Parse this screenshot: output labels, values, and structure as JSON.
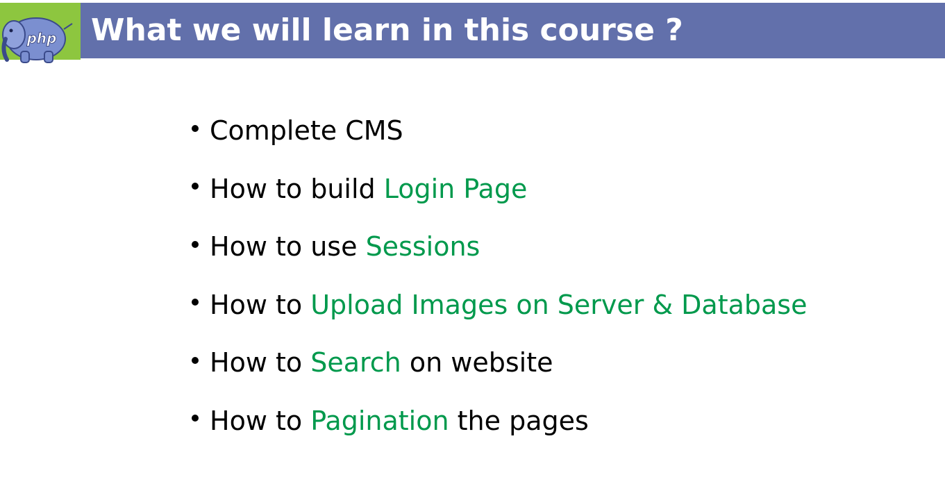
{
  "header": {
    "title": "What we will learn in this course ?",
    "logo_text": "php",
    "colors": {
      "title_bar": "#6270ab",
      "logo_bg": "#8dc63f",
      "highlight": "#00994c"
    }
  },
  "bullets": [
    {
      "plain_before": "Complete CMS",
      "highlight": "",
      "plain_after": ""
    },
    {
      "plain_before": "How to build ",
      "highlight": "Login Page",
      "plain_after": ""
    },
    {
      "plain_before": "How to use ",
      "highlight": "Sessions",
      "plain_after": ""
    },
    {
      "plain_before": "How to ",
      "highlight": "Upload Images on Server & Database",
      "plain_after": ""
    },
    {
      "plain_before": "How to ",
      "highlight": "Search",
      "plain_after": " on website"
    },
    {
      "plain_before": "How to ",
      "highlight": "Pagination",
      "plain_after": " the pages"
    }
  ]
}
